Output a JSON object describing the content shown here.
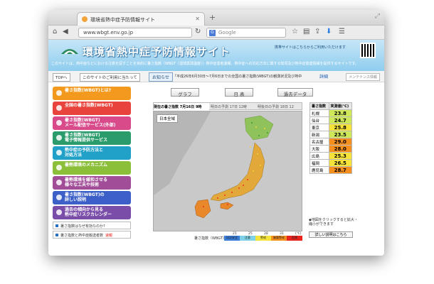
{
  "browser": {
    "tab_title": "環境省熱中症予防情報サイト",
    "url": "www.wbgt.env.go.jp",
    "search_placeholder": "Google",
    "search_engine_label": "G"
  },
  "banner": {
    "site_title": "環境省熱中症予防情報サイト",
    "mobile_note": "携帯サイトはこちらからご利用いただけます",
    "description": "このサイトは、熱中症などにおける注意を促すことを目的に暑さ指数（WBGT（湿球黒球温度））熱中症患者速報、熱中症への対応方法に関する知見及び熱中症関連情報を提供するサイトです。"
  },
  "infobar": {
    "top_label": "TOPへ",
    "about_label": "このサイトのご利用に当たって",
    "notice_button": "お知らせ",
    "notice_text": "「平成26年6月30日〜7月6日までの全国の暑さ指数(WBGT)の観測状況及び熱中",
    "detail_link": "詳細",
    "maintenance_label": "メンテナンス情報"
  },
  "menu": [
    {
      "label": "暑さ指数(WBGT)とは?",
      "color": "#f39a1e"
    },
    {
      "label": "全国の暑さ指数(WBGT)",
      "color": "#e8433c"
    },
    {
      "label": "暑さ指数(WBGT)\nメール配信サービス(外部)",
      "color": "#d94a8a"
    },
    {
      "label": "暑さ指数(WBGT)\n電子情報提供サービス",
      "color": "#2a9b6a"
    },
    {
      "label": "熱中症の予防方法と\n対処方法",
      "color": "#22a1c8"
    },
    {
      "label": "暑熱環境のメカニズム",
      "color": "#8bbf3a"
    },
    {
      "label": "暑熱環境を緩和させる\n様々な工夫や技術",
      "color": "#a24d98"
    },
    {
      "label": "暑さ指数(WBGT)の\n詳しい説明",
      "color": "#3c5fc8"
    },
    {
      "label": "過去の傾向から見る\n熱中症リスクカレンダー",
      "color": "#7a4ea8"
    }
  ],
  "side_links": [
    {
      "label": "暑さ指数はなぜ有効なのか?",
      "badge": ""
    },
    {
      "label": "暑さ指数と熱中症搬送者数",
      "badge": "速報"
    }
  ],
  "view_tabs": [
    "グラフ",
    "日 表",
    "過去データ"
  ],
  "forecast_tabs": [
    {
      "label": "現在の暑さ指数",
      "time": "7月16日 9時"
    },
    {
      "label": "明日の予測",
      "time": "17日 12時"
    },
    {
      "label": "明後日の予測",
      "time": "18日 12"
    }
  ],
  "map": {
    "region_label": "日本全域"
  },
  "legend": {
    "title": "暑さ指数（WBGT）",
    "ticks": [
      "21",
      "25",
      "28",
      "31",
      "(℃)"
    ],
    "levels": [
      {
        "label": "ほぼ安全",
        "color": "#3a7dd6"
      },
      {
        "label": "注意",
        "color": "#7fd1e8"
      },
      {
        "label": "警戒",
        "color": "#f5e23a"
      },
      {
        "label": "厳重警戒",
        "color": "#f58f1e"
      },
      {
        "label": "危険",
        "color": "#e8231e"
      }
    ]
  },
  "wbgt_table": {
    "header_city": "暑さ指数",
    "header_value": "実測値(℃)",
    "rows": [
      {
        "city": "札幌",
        "value": "23.8",
        "color": "#cfe85a"
      },
      {
        "city": "仙台",
        "value": "24.7",
        "color": "#cfe85a"
      },
      {
        "city": "東京",
        "value": "25.8",
        "color": "#f5e23a"
      },
      {
        "city": "新潟",
        "value": "23.5",
        "color": "#cfe85a"
      },
      {
        "city": "名古屋",
        "value": "29.0",
        "color": "#f58f1e"
      },
      {
        "city": "大阪",
        "value": "28.0",
        "color": "#f58f1e"
      },
      {
        "city": "広島",
        "value": "25.3",
        "color": "#f5e23a"
      },
      {
        "city": "福岡",
        "value": "26.5",
        "color": "#f5e23a"
      },
      {
        "city": "鹿児島",
        "value": "28.7",
        "color": "#f58f1e"
      }
    ]
  },
  "side_note": "◆地図をクリックすると拡大・縮小ができます",
  "explain_button": "詳しい説明はこちら"
}
